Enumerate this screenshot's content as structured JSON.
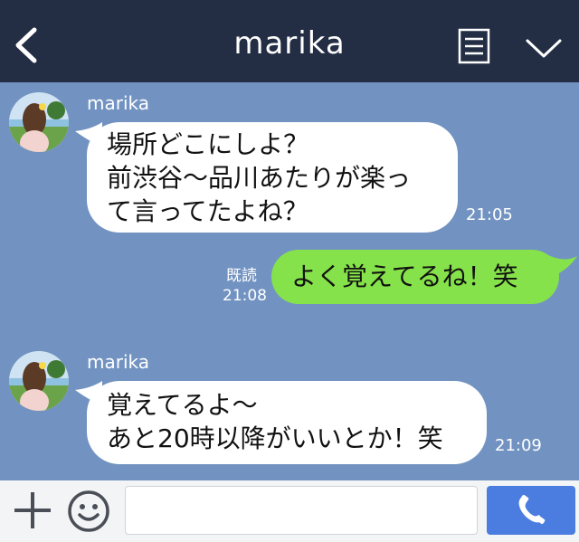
{
  "header": {
    "title": "marika"
  },
  "messages": [
    {
      "sender": "marika",
      "lines": [
        "場所どこにしよ？",
        "前渋谷〜品川あたりが楽っ",
        "て言ってたよね？"
      ],
      "time": "21:05"
    },
    {
      "lines": [
        "よく覚えてるね！笑"
      ],
      "read": "既読",
      "time": "21:08"
    },
    {
      "sender": "marika",
      "lines": [
        "覚えてるよ〜",
        "あと20時以降がいいとか！笑"
      ],
      "time": "21:09"
    }
  ],
  "input": {
    "value": ""
  },
  "colors": {
    "header": "#232d44",
    "chat_bg": "#7293c1",
    "sent_bubble": "#85e24a",
    "call_button": "#4b7de0"
  }
}
